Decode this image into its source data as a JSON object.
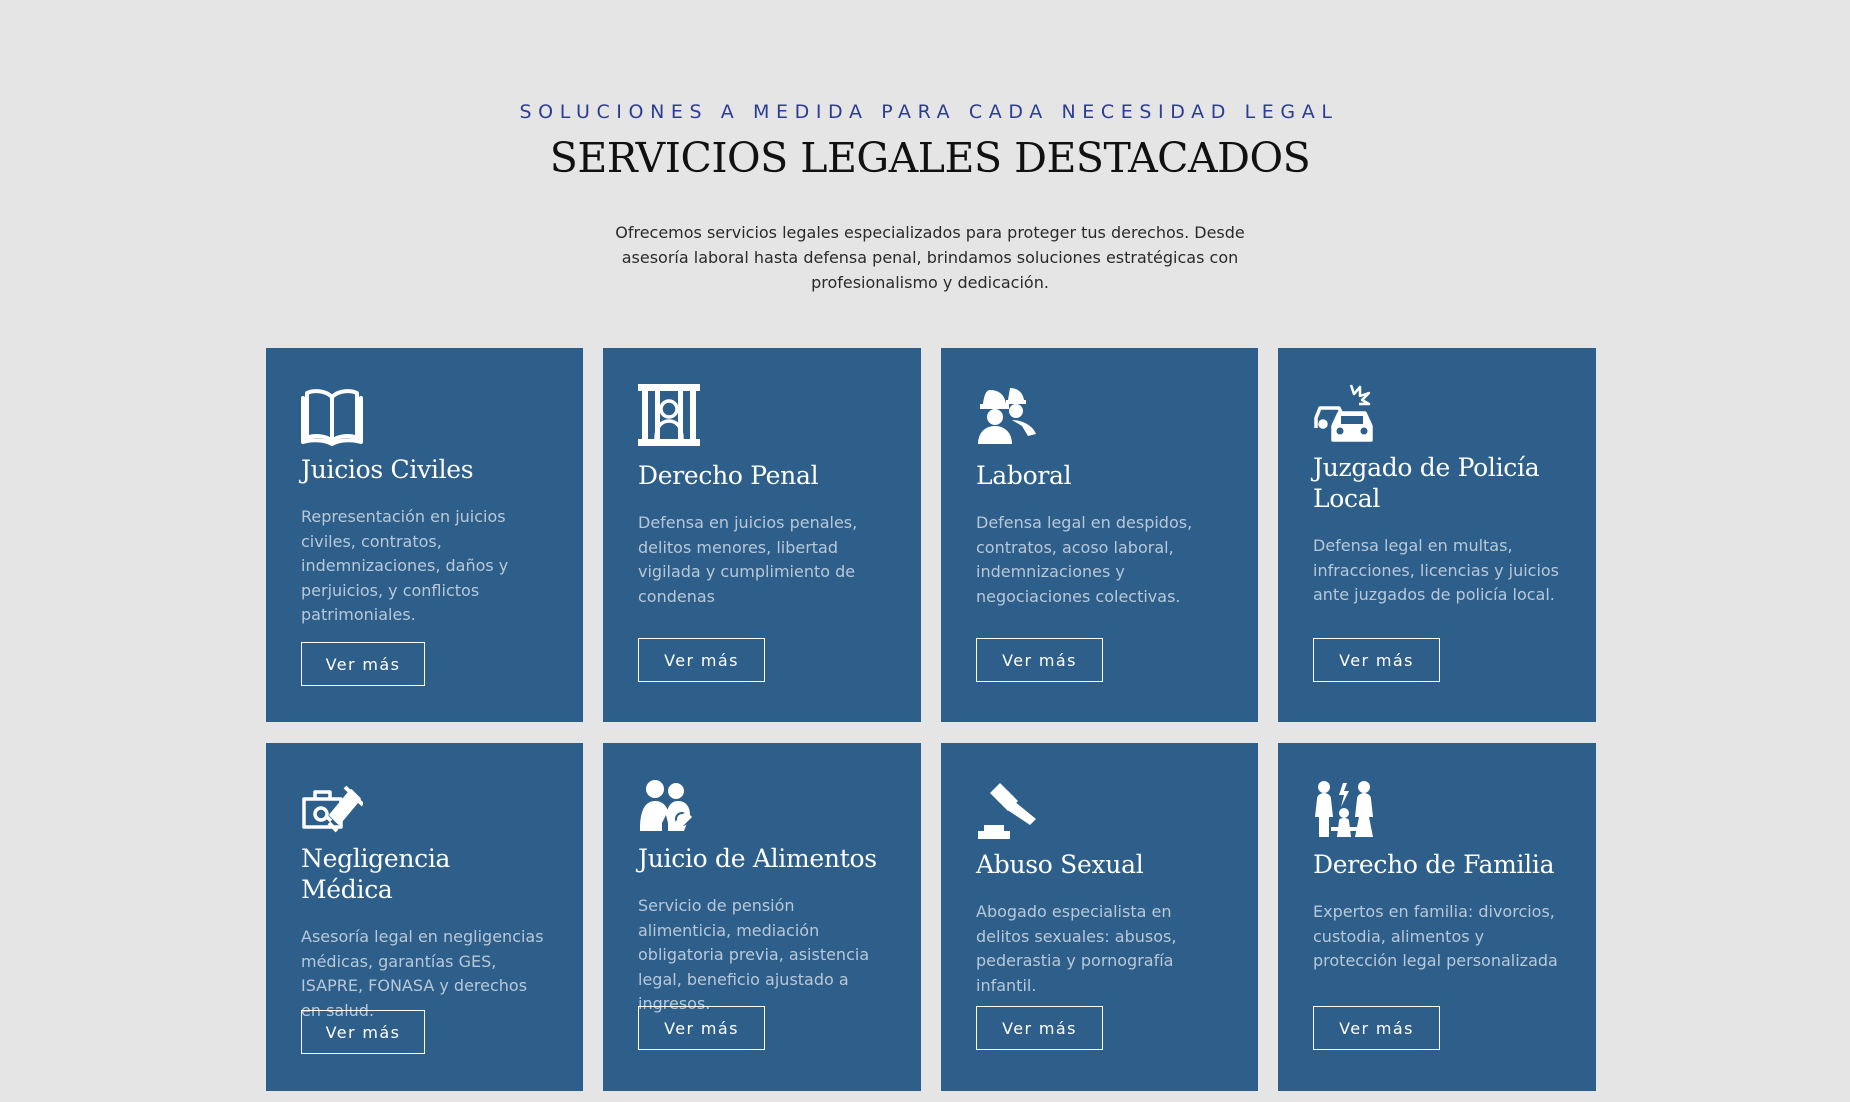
{
  "header": {
    "eyebrow": "SOLUCIONES A MEDIDA PARA CADA NECESIDAD LEGAL",
    "title": "SERVICIOS LEGALES DESTACADOS",
    "intro": "Ofrecemos servicios legales especializados para proteger tus derechos. Desde asesoría laboral hasta defensa penal, brindamos soluciones estratégicas con profesionalismo y dedicación."
  },
  "colors": {
    "background": "#e5e5e5",
    "card": "#2d5f8a",
    "eyebrow": "#2b3d94",
    "card_text": "#b9c8d8"
  },
  "services": [
    {
      "title": "Juicios Civiles",
      "description": "Representación en juicios civiles, contratos, indemnizaciones, daños y perjuicios, y conflictos patrimoniales.",
      "button": "Ver más",
      "icon": "open-book-icon"
    },
    {
      "title": "Derecho Penal",
      "description": "Defensa en juicios penales, delitos menores, libertad vigilada y cumplimiento de condenas",
      "button": "Ver más",
      "icon": "prisoner-behind-bars-icon"
    },
    {
      "title": "Laboral",
      "description": "Defensa legal en despidos, contratos, acoso laboral, indemnizaciones y negociaciones colectivas.",
      "button": "Ver más",
      "icon": "construction-workers-icon"
    },
    {
      "title": "Juzgado de Policía Local",
      "description": "Defensa legal en multas, infracciones, licencias y juicios ante juzgados de policía local.",
      "button": "Ver más",
      "icon": "car-collision-icon"
    },
    {
      "title": "Negligencia Médica",
      "description": "Asesoría legal en negligencias médicas, garantías GES, ISAPRE, FONASA y derechos en salud.",
      "button": "Ver más",
      "icon": "medical-case-gavel-icon"
    },
    {
      "title": "Juicio de Alimentos",
      "description": "Servicio de pensión alimenticia, mediación obligatoria previa, asistencia legal, beneficio ajustado a ingresos.",
      "button": "Ver más",
      "icon": "parent-child-icon"
    },
    {
      "title": "Abuso Sexual",
      "description": "Abogado especialista en delitos sexuales: abusos, pederastia y pornografía infantil.",
      "button": "Ver más",
      "icon": "gavel-icon"
    },
    {
      "title": "Derecho de Familia",
      "description": "Expertos en familia: divorcios, custodia, alimentos y protección legal personalizada",
      "button": "Ver más",
      "icon": "family-dispute-icon"
    }
  ]
}
